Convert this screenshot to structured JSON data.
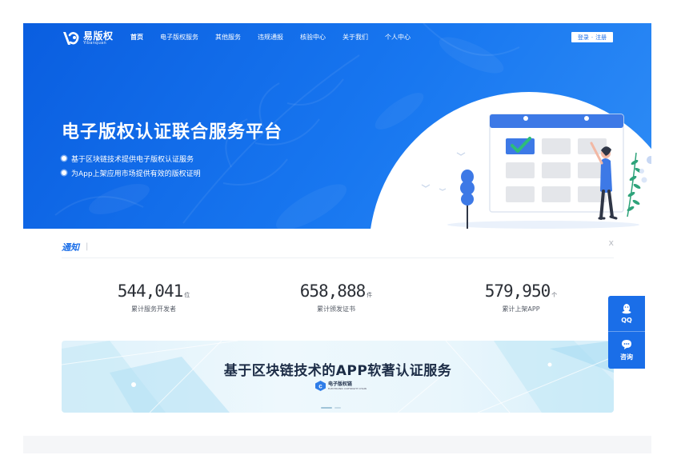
{
  "header": {
    "logo": {
      "name": "易版权",
      "sub": "Yibanquan"
    },
    "nav": [
      {
        "label": "首页",
        "active": true
      },
      {
        "label": "电子版权服务",
        "active": false
      },
      {
        "label": "其他服务",
        "active": false
      },
      {
        "label": "违规通报",
        "active": false
      },
      {
        "label": "核验中心",
        "active": false
      },
      {
        "label": "关于我们",
        "active": false
      },
      {
        "label": "个人中心",
        "active": false
      }
    ],
    "login_label": "登录",
    "auth_separator": "·",
    "register_label": "注册"
  },
  "hero": {
    "title": "电子版权认证联合服务平台",
    "bullets": [
      "基于区块链技术提供电子版权认证服务",
      "为App上架应用市场提供有效的版权证明"
    ]
  },
  "notice": {
    "label": "通知",
    "separator": "|",
    "close": "x"
  },
  "stats": [
    {
      "value": "544,041",
      "unit": "位",
      "label": "累计服务开发者"
    },
    {
      "value": "658,888",
      "unit": "件",
      "label": "累计颁发证书"
    },
    {
      "value": "579,950",
      "unit": "个",
      "label": "累计上架APP"
    }
  ],
  "banner": {
    "title": "基于区块链技术的APP软著认证服务",
    "logo_name": "电子版权链",
    "logo_sub": "ELECTRONIC COPYRIGHT CHAIN"
  },
  "float_bar": {
    "qq_label": "QQ",
    "consult_label": "咨询"
  },
  "colors": {
    "primary": "#1a6ee8",
    "hero_start": "#0a5ee0",
    "hero_end": "#2f8df6",
    "text_dark": "#2b2f36",
    "illus_accent": "#3d79e6"
  },
  "icons": {
    "logo": "yibanquan-logo-icon",
    "qq": "qq-penguin-icon",
    "consult": "chat-bubble-icon",
    "banner_logo": "copyright-chain-icon"
  }
}
